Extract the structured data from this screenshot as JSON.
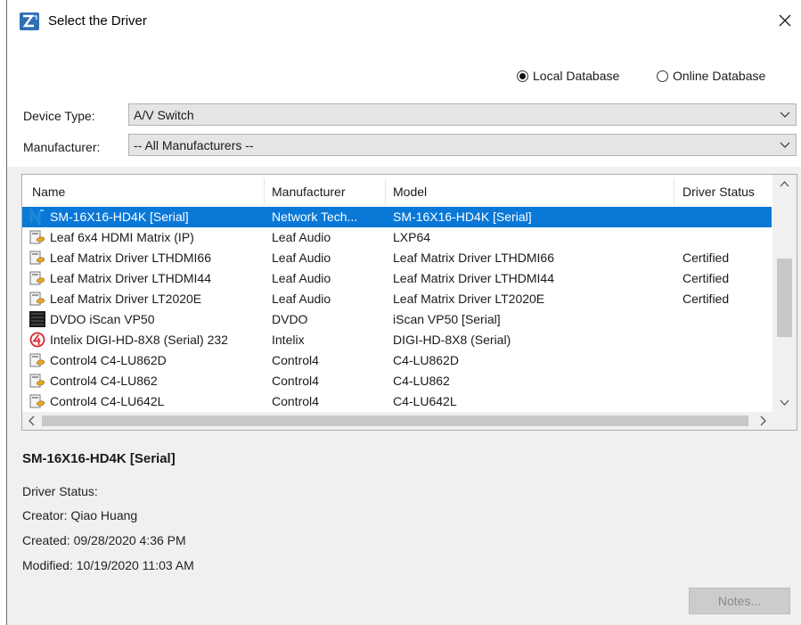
{
  "window": {
    "title": "Select the Driver"
  },
  "database": {
    "local_label": "Local Database",
    "online_label": "Online Database",
    "selected": "local"
  },
  "filters": {
    "device_type_label": "Device Type:",
    "device_type_value": "A/V Switch",
    "manufacturer_label": "Manufacturer:",
    "manufacturer_value": "-- All Manufacturers --"
  },
  "table": {
    "columns": [
      "Name",
      "Manufacturer",
      "Model",
      "Driver Status"
    ],
    "rows": [
      {
        "icon": "network-technologies-icon",
        "name": "SM-16X16-HD4K [Serial]",
        "manufacturer": "Network Tech...",
        "model": "SM-16X16-HD4K [Serial]",
        "status": "",
        "selected": true
      },
      {
        "icon": "driver-package-icon",
        "name": "Leaf 6x4 HDMI Matrix (IP)",
        "manufacturer": "Leaf Audio",
        "model": "LXP64",
        "status": ""
      },
      {
        "icon": "driver-package-icon",
        "name": "Leaf Matrix Driver LTHDMI66",
        "manufacturer": "Leaf Audio",
        "model": "Leaf Matrix Driver LTHDMI66",
        "status": "Certified"
      },
      {
        "icon": "driver-package-icon",
        "name": "Leaf Matrix Driver LTHDMI44",
        "manufacturer": "Leaf Audio",
        "model": "Leaf Matrix Driver LTHDMI44",
        "status": "Certified"
      },
      {
        "icon": "driver-package-icon",
        "name": "Leaf Matrix Driver LT2020E",
        "manufacturer": "Leaf Audio",
        "model": "Leaf Matrix Driver LT2020E",
        "status": "Certified"
      },
      {
        "icon": "dvdo-icon",
        "name": "DVDO iScan VP50",
        "manufacturer": "DVDO",
        "model": "iScan VP50 [Serial]",
        "status": ""
      },
      {
        "icon": "intelix-logo-icon",
        "name": "Intelix DIGI-HD-8X8 (Serial) 232",
        "manufacturer": "Intelix",
        "model": "DIGI-HD-8X8 (Serial)",
        "status": ""
      },
      {
        "icon": "driver-package-icon",
        "name": "Control4 C4-LU862D",
        "manufacturer": "Control4",
        "model": "C4-LU862D",
        "status": ""
      },
      {
        "icon": "driver-package-icon",
        "name": "Control4 C4-LU862",
        "manufacturer": "Control4",
        "model": "C4-LU862",
        "status": ""
      },
      {
        "icon": "driver-package-icon",
        "name": "Control4 C4-LU642L",
        "manufacturer": "Control4",
        "model": "C4-LU642L",
        "status": ""
      }
    ]
  },
  "details": {
    "title": "SM-16X16-HD4K [Serial]",
    "status_line": "Driver Status:",
    "creator_line": "Creator: Qiao Huang",
    "created_line": "Created: 09/28/2020 4:36 PM",
    "modified_line": "Modified: 10/19/2020 11:03 AM"
  },
  "buttons": {
    "notes_label": "Notes..."
  },
  "colors": {
    "selection": "#0a78d7",
    "panel": "#f0f0f0",
    "app_icon": "#2f6fb5",
    "intelix_red": "#d8262d"
  }
}
